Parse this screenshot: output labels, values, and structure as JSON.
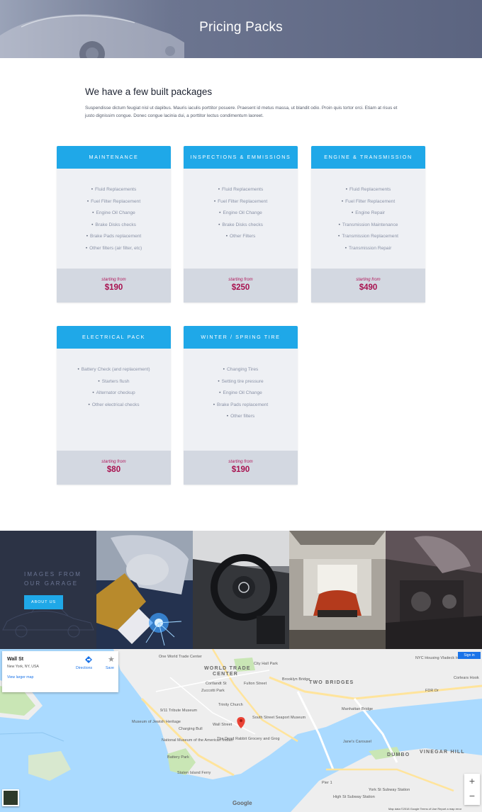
{
  "hero": {
    "title": "Pricing Packs"
  },
  "intro": {
    "heading": "We have a few built packages",
    "body": "Suspendisse dictum feugiat nisl ut dapibus. Mauris iaculis porttitor posuere. Praesent id metus massa, ut blandit odio. Proin quis tortor orci. Etiam at risus et justo dignissim congue. Donec congue lacinia dui, a porttitor lectus condimentum laoreet."
  },
  "packages": [
    {
      "title": "MAINTENANCE",
      "items": [
        "Fluid Replacements",
        "Fuel Filter Replacement",
        "Engine Oil Change",
        "Brake Disks checks",
        "Brake Pads replacement",
        "Other filters (air filter, etc)"
      ],
      "from": "starting from",
      "price": "$190"
    },
    {
      "title": "INSPECTIONS & EMMISSIONS",
      "items": [
        "Fluid Replacements",
        "Fuel Filter Replacement",
        "Engine Oil Change",
        "Brake Disks checks",
        "Other Filters"
      ],
      "from": "starting from",
      "price": "$250"
    },
    {
      "title": "ENGINE & TRANSMISSION",
      "items": [
        "Fluid Replacements",
        "Fuel Filter Replacement",
        "Engine Repair",
        "Transmission Maintenance",
        "Transmission Replacement",
        "Transmission Repair"
      ],
      "from": "starting from",
      "price": "$490"
    },
    {
      "title": "ELECTRICAL PACK",
      "items": [
        "Battery Check (and replacement)",
        "Starters flush",
        "Alternator checkup",
        "Other electrical checks"
      ],
      "from": "starting from",
      "price": "$80"
    },
    {
      "title": "WINTER / SPRING TIRE",
      "items": [
        "Changing Tires",
        "Setting tire pressure",
        "Engine Oil Change",
        "Brake Pads replacement",
        "Other filters"
      ],
      "from": "starting from",
      "price": "$190"
    }
  ],
  "gallery": {
    "title_line1": "IMAGES FROM",
    "title_line2": "OUR GARAGE",
    "button": "ABOUT US"
  },
  "map": {
    "place_name": "Wall St",
    "place_address": "New York, NY, USA",
    "larger_map": "View larger map",
    "directions": "Directions",
    "save": "Save",
    "sign_in": "Sign in",
    "labels": {
      "wtc": "WORLD TRADE",
      "center": "CENTER",
      "two_bridges": "TWO BRIDGES",
      "dumbo": "DUMBO",
      "vinegar_hill": "VINEGAR HILL",
      "wall_street": "Wall Street",
      "city_hall_park": "City Hall Park",
      "fulton": "Fulton Street",
      "brooklyn_bridge": "Brooklyn Bridge",
      "manhattan_bridge": "Manhattan Bridge",
      "south_street": "South Street Seaport Museum",
      "dead_rabbit": "The Dead Rabbit Grocery and Grog",
      "battery_park": "Battery Park",
      "museum_jewish": "Museum of Jewish Heritage",
      "nmai": "National Museum of the American Indian",
      "charging_bull": "Charging Bull",
      "trinity": "Trinity Church",
      "memorial": "9/11 Tribute Museum",
      "nyc_housing": "NYC Housing Vladeck Houses",
      "one_world": "One World Trade Center",
      "zuccotti": "Zuccotti Park",
      "cortlandt": "Cortlandt St",
      "fdr": "FDR Dr",
      "janes": "Jane's Carousel",
      "staten": "Staten Island Ferry",
      "corlears": "Corlears Hook",
      "york_st": "York St Subway Station",
      "high_st": "High St Subway Station",
      "pier": "Pier 1"
    },
    "google": "Google",
    "footer": "Map data ©2018 Google    Terms of Use    Report a map error",
    "zoom_in": "+",
    "zoom_out": "−"
  },
  "colors": {
    "accent": "#1fa8e8",
    "price": "#a8114f",
    "dark": "#2c3345"
  }
}
